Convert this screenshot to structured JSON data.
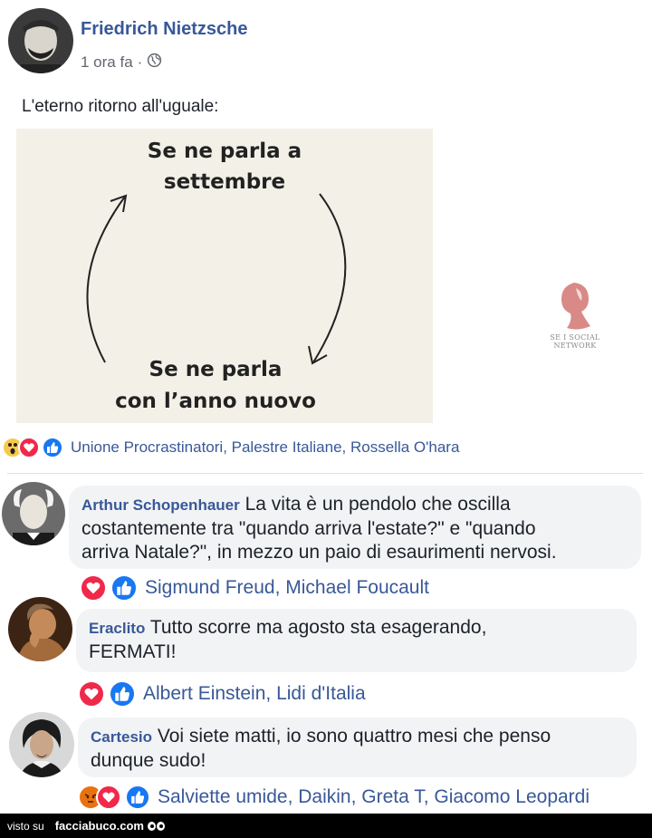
{
  "post": {
    "author": "Friedrich Nietzsche",
    "time": "1 ora fa",
    "separator": "·",
    "text": "L'eterno ritorno all'uguale:",
    "meme": {
      "top_line1": "Se ne parla a",
      "top_line2": "settembre",
      "bottom_line1": "Se ne parla",
      "bottom_line2": "con l’anno nuovo"
    },
    "watermark": {
      "line1": "SE I SOCIAL",
      "line2": "NETWORK"
    },
    "reactions": {
      "icons": [
        "wow-icon",
        "love-icon",
        "like-icon"
      ],
      "names": "Unione Procrastinatori, Palestre Italiane, Rossella O'hara"
    }
  },
  "comments": [
    {
      "name": "Arthur Schopenhauer",
      "text_line1": "La vita è un pendolo che oscilla",
      "text_line2": "costantemente tra \"quando arriva l'estate?\" e \"quando",
      "text_line3": "arriva Natale?\", in mezzo un paio di esaurimenti nervosi.",
      "reaction_names": "Sigmund Freud, Michael Foucault"
    },
    {
      "name": "Eraclito",
      "text_line1": "Tutto scorre ma agosto sta esagerando,",
      "text_line2": "FERMATI!",
      "reaction_names": "Albert Einstein, Lidi d'Italia"
    },
    {
      "name": "Cartesio",
      "text_line1": "Voi siete matti, io sono quattro mesi che penso",
      "text_line2": "dunque sudo!",
      "reaction_names": "Salviette umide, Daikin, Greta T, Giacomo Leopardi"
    }
  ],
  "footer": {
    "prefix": "visto su",
    "brand": "facciabuco.com"
  },
  "colors": {
    "link_blue": "#385898",
    "love_red": "#f0284a",
    "like_blue": "#1877f2",
    "wow_yellow": "#f7c94b",
    "angry_orange": "#e9710f"
  }
}
